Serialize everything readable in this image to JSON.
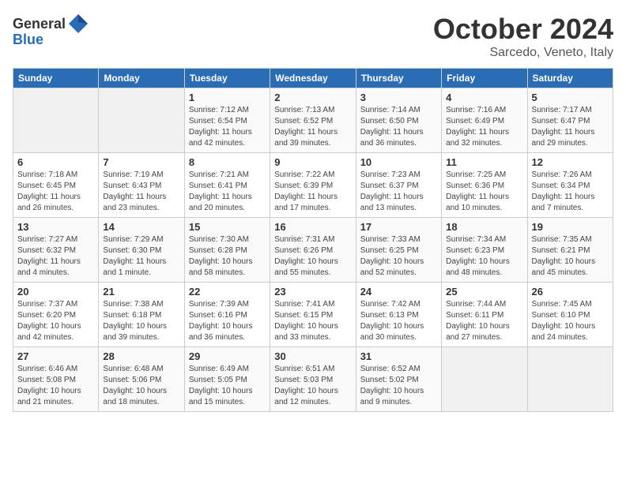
{
  "logo": {
    "general": "General",
    "blue": "Blue"
  },
  "header": {
    "month": "October 2024",
    "location": "Sarcedo, Veneto, Italy"
  },
  "days_of_week": [
    "Sunday",
    "Monday",
    "Tuesday",
    "Wednesday",
    "Thursday",
    "Friday",
    "Saturday"
  ],
  "weeks": [
    [
      {
        "day": "",
        "empty": true
      },
      {
        "day": "",
        "empty": true
      },
      {
        "day": "1",
        "sunrise": "7:12 AM",
        "sunset": "6:54 PM",
        "daylight": "11 hours and 42 minutes."
      },
      {
        "day": "2",
        "sunrise": "7:13 AM",
        "sunset": "6:52 PM",
        "daylight": "11 hours and 39 minutes."
      },
      {
        "day": "3",
        "sunrise": "7:14 AM",
        "sunset": "6:50 PM",
        "daylight": "11 hours and 36 minutes."
      },
      {
        "day": "4",
        "sunrise": "7:16 AM",
        "sunset": "6:49 PM",
        "daylight": "11 hours and 32 minutes."
      },
      {
        "day": "5",
        "sunrise": "7:17 AM",
        "sunset": "6:47 PM",
        "daylight": "11 hours and 29 minutes."
      }
    ],
    [
      {
        "day": "6",
        "sunrise": "7:18 AM",
        "sunset": "6:45 PM",
        "daylight": "11 hours and 26 minutes."
      },
      {
        "day": "7",
        "sunrise": "7:19 AM",
        "sunset": "6:43 PM",
        "daylight": "11 hours and 23 minutes."
      },
      {
        "day": "8",
        "sunrise": "7:21 AM",
        "sunset": "6:41 PM",
        "daylight": "11 hours and 20 minutes."
      },
      {
        "day": "9",
        "sunrise": "7:22 AM",
        "sunset": "6:39 PM",
        "daylight": "11 hours and 17 minutes."
      },
      {
        "day": "10",
        "sunrise": "7:23 AM",
        "sunset": "6:37 PM",
        "daylight": "11 hours and 13 minutes."
      },
      {
        "day": "11",
        "sunrise": "7:25 AM",
        "sunset": "6:36 PM",
        "daylight": "11 hours and 10 minutes."
      },
      {
        "day": "12",
        "sunrise": "7:26 AM",
        "sunset": "6:34 PM",
        "daylight": "11 hours and 7 minutes."
      }
    ],
    [
      {
        "day": "13",
        "sunrise": "7:27 AM",
        "sunset": "6:32 PM",
        "daylight": "11 hours and 4 minutes."
      },
      {
        "day": "14",
        "sunrise": "7:29 AM",
        "sunset": "6:30 PM",
        "daylight": "11 hours and 1 minute."
      },
      {
        "day": "15",
        "sunrise": "7:30 AM",
        "sunset": "6:28 PM",
        "daylight": "10 hours and 58 minutes."
      },
      {
        "day": "16",
        "sunrise": "7:31 AM",
        "sunset": "6:26 PM",
        "daylight": "10 hours and 55 minutes."
      },
      {
        "day": "17",
        "sunrise": "7:33 AM",
        "sunset": "6:25 PM",
        "daylight": "10 hours and 52 minutes."
      },
      {
        "day": "18",
        "sunrise": "7:34 AM",
        "sunset": "6:23 PM",
        "daylight": "10 hours and 48 minutes."
      },
      {
        "day": "19",
        "sunrise": "7:35 AM",
        "sunset": "6:21 PM",
        "daylight": "10 hours and 45 minutes."
      }
    ],
    [
      {
        "day": "20",
        "sunrise": "7:37 AM",
        "sunset": "6:20 PM",
        "daylight": "10 hours and 42 minutes."
      },
      {
        "day": "21",
        "sunrise": "7:38 AM",
        "sunset": "6:18 PM",
        "daylight": "10 hours and 39 minutes."
      },
      {
        "day": "22",
        "sunrise": "7:39 AM",
        "sunset": "6:16 PM",
        "daylight": "10 hours and 36 minutes."
      },
      {
        "day": "23",
        "sunrise": "7:41 AM",
        "sunset": "6:15 PM",
        "daylight": "10 hours and 33 minutes."
      },
      {
        "day": "24",
        "sunrise": "7:42 AM",
        "sunset": "6:13 PM",
        "daylight": "10 hours and 30 minutes."
      },
      {
        "day": "25",
        "sunrise": "7:44 AM",
        "sunset": "6:11 PM",
        "daylight": "10 hours and 27 minutes."
      },
      {
        "day": "26",
        "sunrise": "7:45 AM",
        "sunset": "6:10 PM",
        "daylight": "10 hours and 24 minutes."
      }
    ],
    [
      {
        "day": "27",
        "sunrise": "6:46 AM",
        "sunset": "5:08 PM",
        "daylight": "10 hours and 21 minutes."
      },
      {
        "day": "28",
        "sunrise": "6:48 AM",
        "sunset": "5:06 PM",
        "daylight": "10 hours and 18 minutes."
      },
      {
        "day": "29",
        "sunrise": "6:49 AM",
        "sunset": "5:05 PM",
        "daylight": "10 hours and 15 minutes."
      },
      {
        "day": "30",
        "sunrise": "6:51 AM",
        "sunset": "5:03 PM",
        "daylight": "10 hours and 12 minutes."
      },
      {
        "day": "31",
        "sunrise": "6:52 AM",
        "sunset": "5:02 PM",
        "daylight": "10 hours and 9 minutes."
      },
      {
        "day": "",
        "empty": true
      },
      {
        "day": "",
        "empty": true
      }
    ]
  ]
}
